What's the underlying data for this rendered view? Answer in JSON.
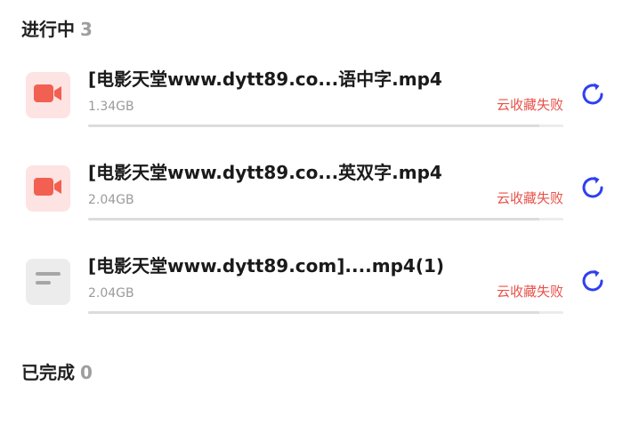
{
  "sections": {
    "in_progress": {
      "label": "进行中",
      "count": "3"
    },
    "completed": {
      "label": "已完成",
      "count": "0"
    }
  },
  "colors": {
    "accent": "#2f3ff0",
    "error": "#e8524a",
    "video_icon": "#f26052",
    "video_bg": "#fde3e1",
    "doc_bg": "#ececec"
  },
  "tasks": [
    {
      "icon": "video-icon",
      "title": "[电影天堂www.dytt89.co...语中字.mp4",
      "size": "1.34GB",
      "status": "云收藏失败",
      "progress": 0.95
    },
    {
      "icon": "video-icon",
      "title": "[电影天堂www.dytt89.co...英双字.mp4",
      "size": "2.04GB",
      "status": "云收藏失败",
      "progress": 0.95
    },
    {
      "icon": "document-icon",
      "title": "[电影天堂www.dytt89.com]....mp4(1)",
      "size": "2.04GB",
      "status": "云收藏失败",
      "progress": 0.95
    }
  ]
}
